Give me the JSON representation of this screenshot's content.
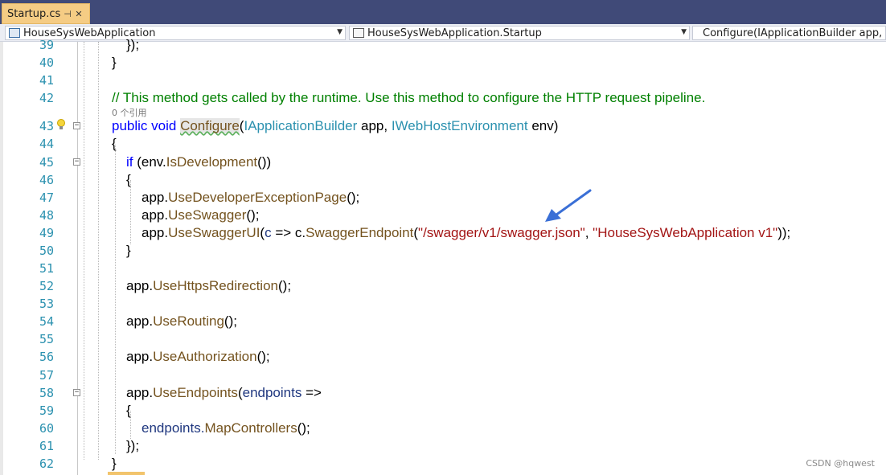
{
  "tab": {
    "title": "Startup.cs",
    "pin": "⊣",
    "close": "✕"
  },
  "nav": {
    "project": "HouseSysWebApplication",
    "class": "HouseSysWebApplication.Startup",
    "member": "Configure(IApplicationBuilder app, IW",
    "arrow": "▼"
  },
  "codelens": "0 个引用",
  "lines": [
    {
      "n": "39"
    },
    {
      "n": "40"
    },
    {
      "n": "41"
    },
    {
      "n": "42"
    },
    {
      "n": "43"
    },
    {
      "n": "44"
    },
    {
      "n": "45"
    },
    {
      "n": "46"
    },
    {
      "n": "47"
    },
    {
      "n": "48"
    },
    {
      "n": "49"
    },
    {
      "n": "50"
    },
    {
      "n": "51"
    },
    {
      "n": "52"
    },
    {
      "n": "53"
    },
    {
      "n": "54"
    },
    {
      "n": "55"
    },
    {
      "n": "56"
    },
    {
      "n": "57"
    },
    {
      "n": "58"
    },
    {
      "n": "59"
    },
    {
      "n": "60"
    },
    {
      "n": "61"
    },
    {
      "n": "62"
    }
  ],
  "code": {
    "l39": "});",
    "l40": "}",
    "l42": "// This method gets called by the runtime. Use this method to configure the HTTP request pipeline.",
    "l43_public": "public",
    "l43_void": "void",
    "l43_method": "Configure",
    "l43_open": "(",
    "l43_t1": "IApplicationBuilder",
    "l43_p1": " app, ",
    "l43_t2": "IWebHostEnvironment",
    "l43_p2": " env)",
    "l44": "{",
    "l45_if": "if",
    "l45_a": " (env.",
    "l45_m": "IsDevelopment",
    "l45_b": "())",
    "l46": "{",
    "l47_a": "app.",
    "l47_m": "UseDeveloperExceptionPage",
    "l47_b": "();",
    "l48_a": "app.",
    "l48_m": "UseSwagger",
    "l48_b": "();",
    "l49_a": "app.",
    "l49_m": "UseSwaggerUI",
    "l49_b": "(",
    "l49_c": "c",
    "l49_d": " => ",
    "l49_e": "c.",
    "l49_f": "SwaggerEndpoint",
    "l49_g": "(",
    "l49_s1": "\"/swagger/v1/swagger.json\"",
    "l49_h": ", ",
    "l49_s2": "\"HouseSysWebApplication v1\"",
    "l49_i": "));",
    "l50": "}",
    "l52_a": "app.",
    "l52_m": "UseHttpsRedirection",
    "l52_b": "();",
    "l54_a": "app.",
    "l54_m": "UseRouting",
    "l54_b": "();",
    "l56_a": "app.",
    "l56_m": "UseAuthorization",
    "l56_b": "();",
    "l58_a": "app.",
    "l58_m": "UseEndpoints",
    "l58_b": "(",
    "l58_c": "endpoints",
    "l58_d": " =>",
    "l59": "{",
    "l60_a": "endpoints.",
    "l60_m": "MapControllers",
    "l60_b": "();",
    "l61": "});",
    "l62": "}"
  },
  "watermark": "CSDN @hqwest",
  "colors": {
    "tab_bg": "#f5cc84",
    "tabbar_bg": "#404a78",
    "arrow": "#3a6fd6"
  }
}
